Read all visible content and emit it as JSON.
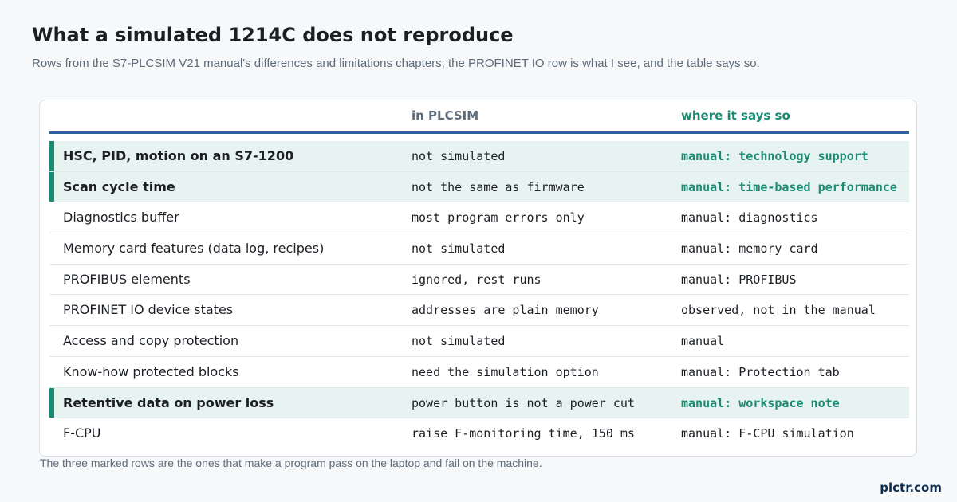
{
  "title": "What a simulated 1214C does not reproduce",
  "subtitle": "Rows from the S7-PLCSIM V21 manual's differences and limitations chapters; the PROFINET IO row is what I see, and the table says so.",
  "table": {
    "headers": [
      "",
      "in PLCSIM",
      "where it says so"
    ],
    "rows": [
      {
        "item": "HSC, PID, motion on an S7-1200",
        "plcsim": "not simulated",
        "source": "manual: technology support",
        "flagged": true
      },
      {
        "item": "Scan cycle time",
        "plcsim": "not the same as firmware",
        "source": "manual: time-based performance",
        "flagged": true
      },
      {
        "item": "Diagnostics buffer",
        "plcsim": "most program errors only",
        "source": "manual: diagnostics",
        "flagged": false
      },
      {
        "item": "Memory card features (data log, recipes)",
        "plcsim": "not simulated",
        "source": "manual: memory card",
        "flagged": false
      },
      {
        "item": "PROFIBUS elements",
        "plcsim": "ignored, rest runs",
        "source": "manual: PROFIBUS",
        "flagged": false
      },
      {
        "item": "PROFINET IO device states",
        "plcsim": "addresses are plain memory",
        "source": "observed, not in the manual",
        "flagged": false
      },
      {
        "item": "Access and copy protection",
        "plcsim": "not simulated",
        "source": "manual",
        "flagged": false
      },
      {
        "item": "Know-how protected blocks",
        "plcsim": "need the simulation option",
        "source": "manual: Protection tab",
        "flagged": false
      },
      {
        "item": "Retentive data on power loss",
        "plcsim": "power button is not a power cut",
        "source": "manual: workspace note",
        "flagged": true
      },
      {
        "item": "F-CPU",
        "plcsim": "raise F-monitoring time, 150 ms",
        "source": "manual: F-CPU simulation",
        "flagged": false
      }
    ]
  },
  "footnote": "The three marked rows are the ones that make a program pass on the laptop and fail on the machine.",
  "brand": "plctr.com",
  "colors": {
    "accent": "#1a8a72",
    "header_rule": "#2e5f9e",
    "flagged_row_bg": "#e7f3f0"
  }
}
